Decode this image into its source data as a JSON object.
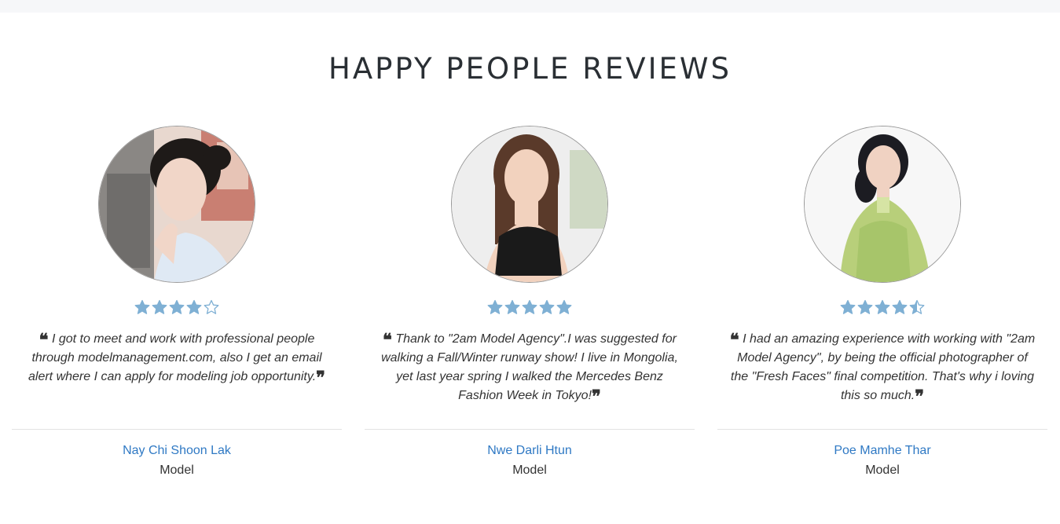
{
  "section": {
    "title": "HAPPY PEOPLE REVIEWS"
  },
  "colors": {
    "star": "#7fb0d4",
    "name_link": "#2f79c4",
    "divider": "#e3e3e3"
  },
  "reviews": [
    {
      "rating": 4,
      "quote": "I got to meet and work with professional people through modelmanagement.com, also I get an email alert where I can apply for modeling job opportunity.",
      "name": "Nay Chi Shoon Lak",
      "role": "Model"
    },
    {
      "rating": 5,
      "quote": "Thank to \"2am Model Agency\".I was suggested for walking a Fall/Winter runway show! I live in Mongolia, yet last year spring I walked the Mercedes Benz Fashion Week in Tokyo!",
      "name": "Nwe Darli Htun",
      "role": "Model"
    },
    {
      "rating": 4.5,
      "quote": "I had an amazing experience with working with \"2am Model Agency\", by being the official photographer of the \"Fresh Faces\" final competition. That's why i loving this so much.",
      "name": "Poe Mamhe Thar",
      "role": "Model"
    }
  ]
}
